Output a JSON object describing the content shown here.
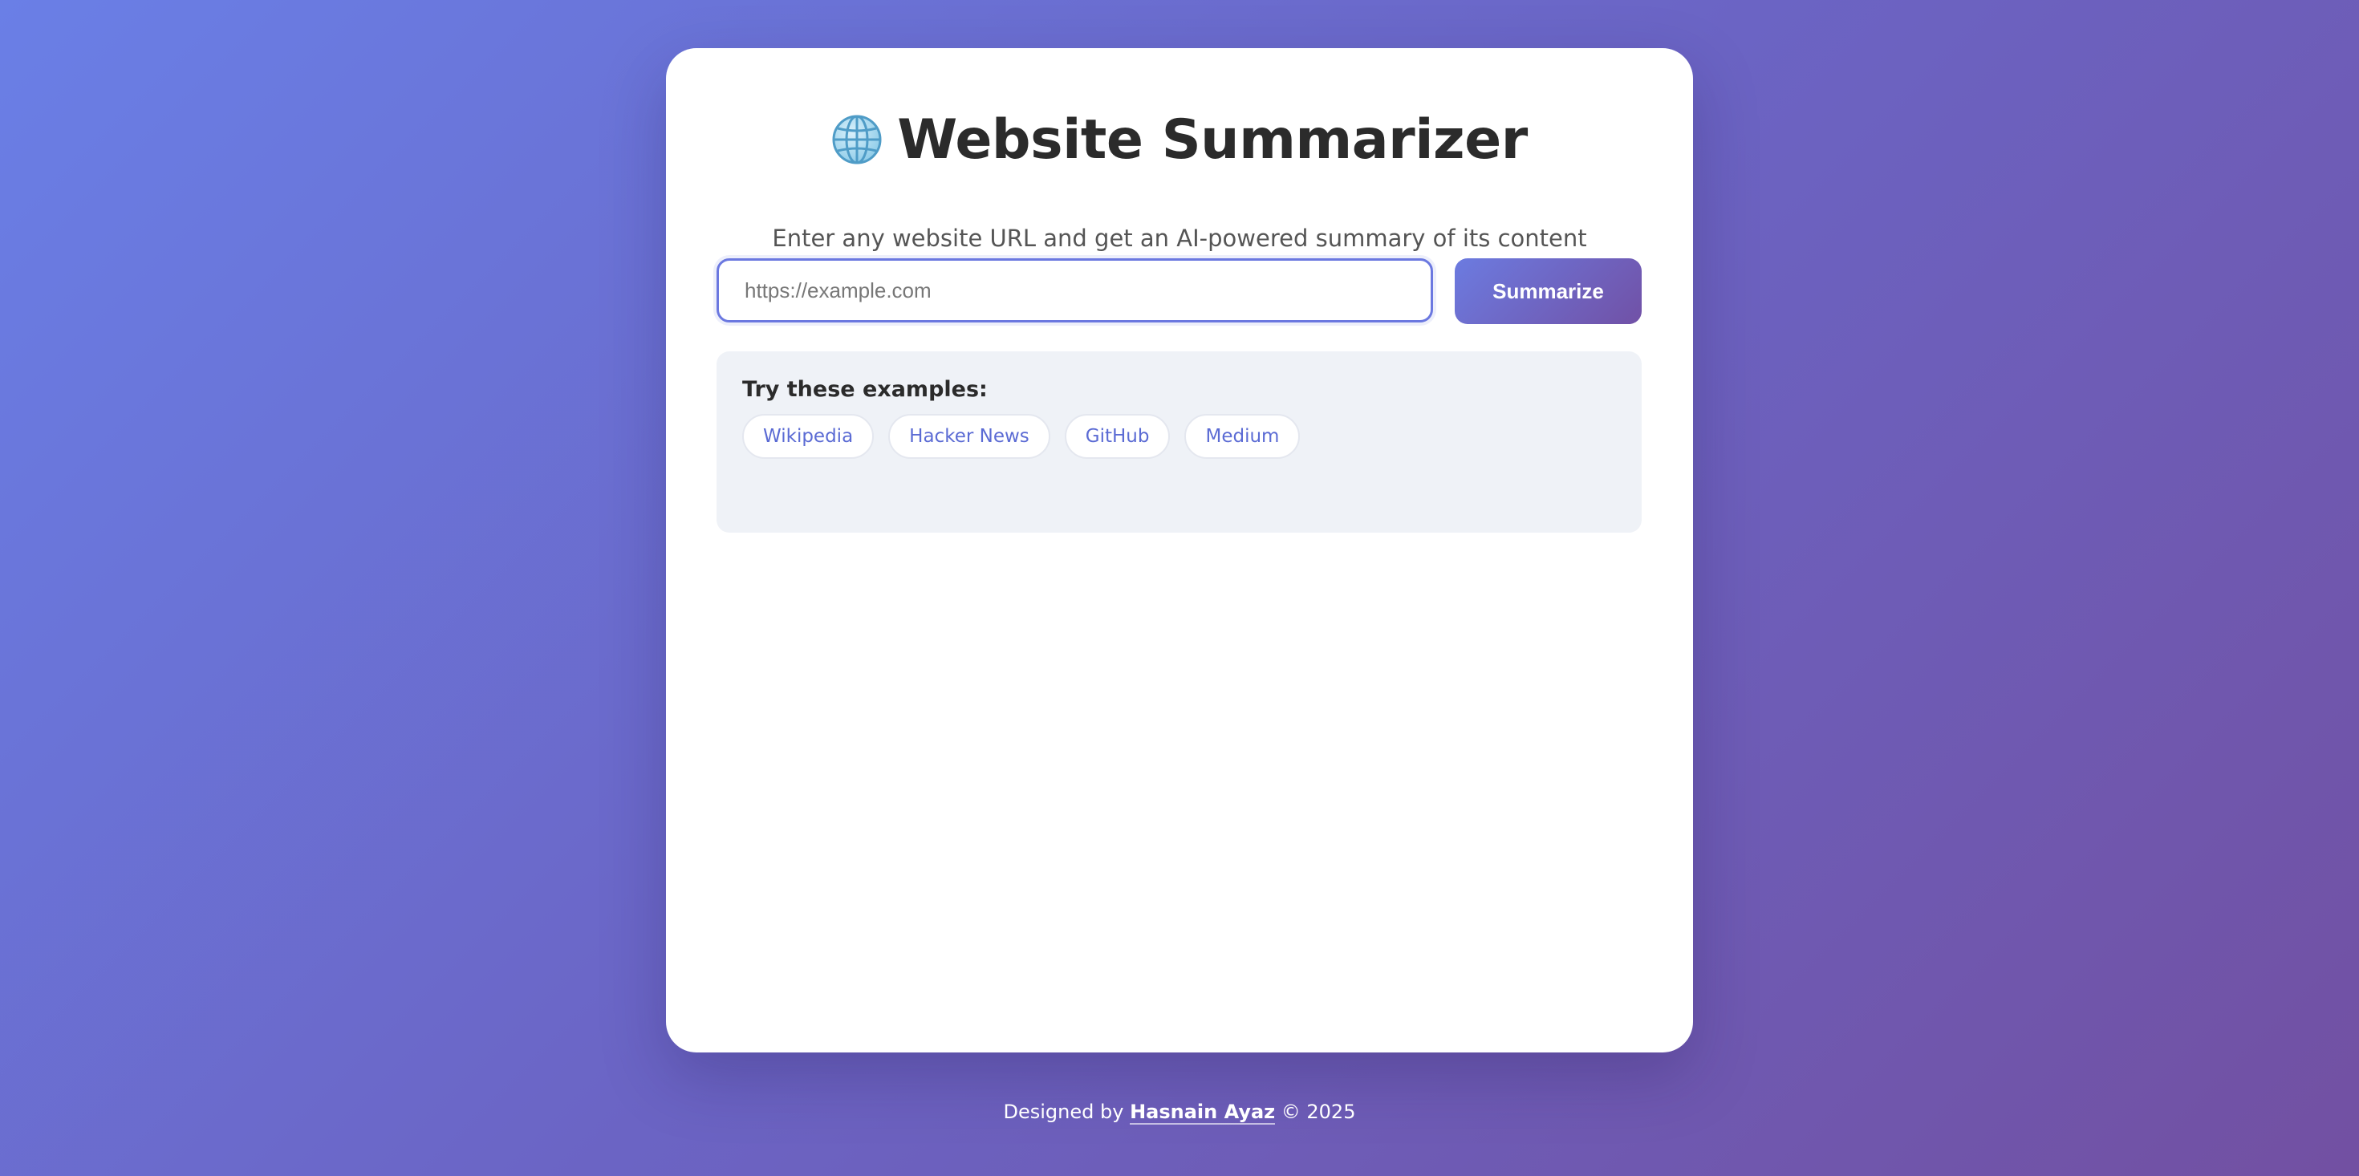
{
  "header": {
    "icon": "globe-icon",
    "title": "Website Summarizer",
    "subtitle": "Enter any website URL and get an AI-powered summary of its content"
  },
  "form": {
    "url_placeholder": "https://example.com",
    "url_value": "",
    "submit_label": "Summarize"
  },
  "examples": {
    "heading": "Try these examples:",
    "items": [
      {
        "label": "Wikipedia"
      },
      {
        "label": "Hacker News"
      },
      {
        "label": "GitHub"
      },
      {
        "label": "Medium"
      }
    ]
  },
  "footer": {
    "prefix": "Designed by",
    "author": "Hasnain Ayaz",
    "suffix": "© 2025"
  },
  "colors": {
    "accent": "#6b78e0",
    "accent_dark": "#7151a6",
    "chip_text": "#5b6bd4",
    "examples_bg": "#eff2f7"
  }
}
